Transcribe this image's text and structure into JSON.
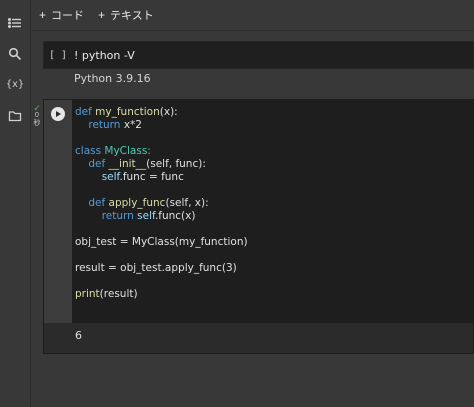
{
  "toolbar": {
    "add_code_label": "コード",
    "add_text_label": "テキスト",
    "plus_symbol": "+"
  },
  "sidebar": {
    "variables_label": "{x}"
  },
  "cells": {
    "cell1": {
      "bracket": "[ ]",
      "code": "! python -V",
      "output": "Python 3.9.16"
    },
    "cell2": {
      "status_check": "✓",
      "status_time": "0",
      "status_unit": "秒",
      "lines": [
        {
          "tokens": [
            {
              "t": "def ",
              "c": "kw"
            },
            {
              "t": "my_function",
              "c": "fn"
            },
            {
              "t": "(x):",
              "c": "plain"
            }
          ]
        },
        {
          "tokens": [
            {
              "t": "    ",
              "c": "plain"
            },
            {
              "t": "return ",
              "c": "kw"
            },
            {
              "t": "x*2",
              "c": "plain"
            }
          ]
        },
        {
          "tokens": []
        },
        {
          "tokens": [
            {
              "t": "class ",
              "c": "kw"
            },
            {
              "t": "MyClass:",
              "c": "cls"
            }
          ]
        },
        {
          "tokens": [
            {
              "t": "    ",
              "c": "plain"
            },
            {
              "t": "def ",
              "c": "kw"
            },
            {
              "t": "__init__",
              "c": "fn"
            },
            {
              "t": "(self, func):",
              "c": "plain"
            }
          ]
        },
        {
          "tokens": [
            {
              "t": "        ",
              "c": "plain"
            },
            {
              "t": "self",
              "c": "self"
            },
            {
              "t": ".func = func",
              "c": "plain"
            }
          ]
        },
        {
          "tokens": []
        },
        {
          "tokens": [
            {
              "t": "    ",
              "c": "plain"
            },
            {
              "t": "def ",
              "c": "kw"
            },
            {
              "t": "apply_func",
              "c": "fn"
            },
            {
              "t": "(self, x):",
              "c": "plain"
            }
          ]
        },
        {
          "tokens": [
            {
              "t": "        ",
              "c": "plain"
            },
            {
              "t": "return ",
              "c": "kw"
            },
            {
              "t": "self",
              "c": "self"
            },
            {
              "t": ".func(x)",
              "c": "plain"
            }
          ]
        },
        {
          "tokens": []
        },
        {
          "tokens": [
            {
              "t": "obj_test = MyClass(my_function)",
              "c": "plain"
            }
          ]
        },
        {
          "tokens": []
        },
        {
          "tokens": [
            {
              "t": "result = obj_test.apply_func(3)",
              "c": "plain"
            }
          ]
        },
        {
          "tokens": []
        },
        {
          "tokens": [
            {
              "t": "print",
              "c": "fn"
            },
            {
              "t": "(result)",
              "c": "plain"
            }
          ]
        }
      ],
      "output": "6"
    }
  }
}
